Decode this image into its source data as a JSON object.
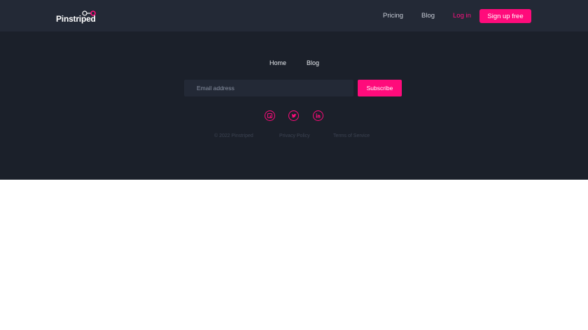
{
  "header": {
    "brand": "Pinstriped",
    "nav": {
      "pricing": "Pricing",
      "blog": "Blog",
      "login": "Log in",
      "signup": "Sign up free"
    }
  },
  "footer": {
    "nav": {
      "home": "Home",
      "blog": "Blog"
    },
    "newsletter": {
      "placeholder": "Email address",
      "value": "",
      "button": "Subscribe"
    },
    "social_icons": [
      "facebook-icon",
      "twitter-icon",
      "linkedin-icon"
    ],
    "legal": {
      "copyright": "© 2022 Pinstriped",
      "privacy": "Privacy Policy",
      "terms": "Terms of Service"
    }
  },
  "colors": {
    "header_bg": "#232936",
    "footer_bg": "#1b202a",
    "accent": "#ff0b7b",
    "page_bg": "#ffffff"
  }
}
